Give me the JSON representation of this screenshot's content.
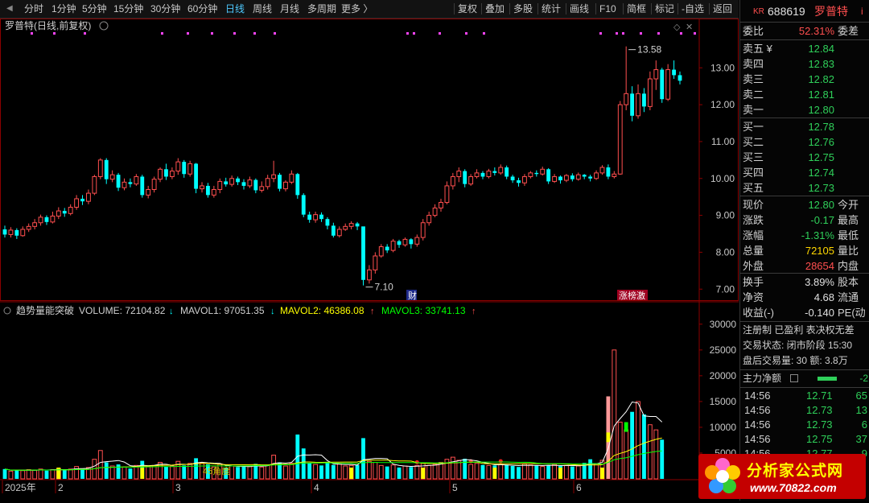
{
  "toolbar": {
    "periods": [
      "分时",
      "1分钟",
      "5分钟",
      "15分钟",
      "30分钟",
      "60分钟",
      "日线",
      "周线",
      "月线",
      "多周期",
      "更多 〉"
    ],
    "active_period": "日线",
    "tools": [
      "复权",
      "叠加",
      "多股",
      "统计",
      "画线",
      "F10",
      "简框",
      "标记",
      "-自选",
      "返回"
    ]
  },
  "chart": {
    "title": "罗普特(日线,前复权)",
    "high_label": "13.58",
    "low_label": "7.10",
    "price_axis": [
      "13.00",
      "12.00",
      "11.00",
      "10.00",
      "9.00",
      "8.00",
      "7.00"
    ],
    "marker_cai": "财",
    "marker_zhang": "涨榜激",
    "indicator_name": "趋势量能突破",
    "volume_label": "VOLUME: 72104.82",
    "mavol1_label": "MAVOL1: 97051.35",
    "mavol2_label": "MAVOL2: 46386.08",
    "mavol3_label": "MAVOL3: 33741.13",
    "vol_axis": [
      "30000",
      "25000",
      "20000",
      "15000",
      "10000",
      "5000"
    ],
    "angle_label": "45角度",
    "date_axis": [
      "2025年",
      "2",
      "3",
      "4",
      "5",
      "6"
    ],
    "colors": {
      "up": "#ff4f4f",
      "down": "#00ffff",
      "ma_white": "#ffffff",
      "ma_yellow": "#ffff00",
      "ma_green": "#00ff00",
      "dot": "#ff44ff"
    }
  },
  "chart_data": {
    "type": "candlestick",
    "ylim": [
      6.7,
      13.9
    ],
    "candles": [
      {
        "o": 8.62,
        "c": 8.48,
        "h": 8.72,
        "l": 8.4
      },
      {
        "o": 8.48,
        "c": 8.6,
        "h": 8.68,
        "l": 8.4
      },
      {
        "o": 8.6,
        "c": 8.45,
        "h": 8.65,
        "l": 8.36
      },
      {
        "o": 8.45,
        "c": 8.62,
        "h": 8.7,
        "l": 8.42
      },
      {
        "o": 8.62,
        "c": 8.7,
        "h": 8.78,
        "l": 8.55
      },
      {
        "o": 8.7,
        "c": 8.8,
        "h": 8.9,
        "l": 8.62
      },
      {
        "o": 8.8,
        "c": 8.95,
        "h": 9.02,
        "l": 8.72
      },
      {
        "o": 8.95,
        "c": 8.82,
        "h": 9.0,
        "l": 8.74
      },
      {
        "o": 8.82,
        "c": 8.98,
        "h": 9.1,
        "l": 8.78
      },
      {
        "o": 8.98,
        "c": 9.12,
        "h": 9.22,
        "l": 8.9
      },
      {
        "o": 9.12,
        "c": 9.05,
        "h": 9.2,
        "l": 8.96
      },
      {
        "o": 9.05,
        "c": 9.22,
        "h": 9.3,
        "l": 9.0
      },
      {
        "o": 9.22,
        "c": 9.45,
        "h": 9.55,
        "l": 9.15
      },
      {
        "o": 9.45,
        "c": 9.38,
        "h": 9.55,
        "l": 9.28
      },
      {
        "o": 9.38,
        "c": 9.6,
        "h": 9.7,
        "l": 9.3
      },
      {
        "o": 9.6,
        "c": 10.05,
        "h": 10.1,
        "l": 9.55
      },
      {
        "o": 10.05,
        "c": 10.5,
        "h": 10.55,
        "l": 9.98
      },
      {
        "o": 10.5,
        "c": 9.98,
        "h": 10.55,
        "l": 9.85
      },
      {
        "o": 9.98,
        "c": 10.1,
        "h": 10.22,
        "l": 9.9
      },
      {
        "o": 10.1,
        "c": 9.75,
        "h": 10.15,
        "l": 9.66
      },
      {
        "o": 9.75,
        "c": 9.9,
        "h": 10.0,
        "l": 9.68
      },
      {
        "o": 9.9,
        "c": 9.85,
        "h": 10.0,
        "l": 9.76
      },
      {
        "o": 9.85,
        "c": 10.05,
        "h": 10.12,
        "l": 9.8
      },
      {
        "o": 10.05,
        "c": 9.55,
        "h": 10.1,
        "l": 9.48
      },
      {
        "o": 9.55,
        "c": 9.7,
        "h": 9.8,
        "l": 9.46
      },
      {
        "o": 9.7,
        "c": 9.98,
        "h": 10.05,
        "l": 9.62
      },
      {
        "o": 9.98,
        "c": 10.25,
        "h": 10.3,
        "l": 9.9
      },
      {
        "o": 10.25,
        "c": 10.05,
        "h": 10.4,
        "l": 9.96
      },
      {
        "o": 10.05,
        "c": 10.2,
        "h": 10.3,
        "l": 9.98
      },
      {
        "o": 10.2,
        "c": 10.45,
        "h": 10.55,
        "l": 10.1
      },
      {
        "o": 10.45,
        "c": 10.12,
        "h": 10.5,
        "l": 10.02
      },
      {
        "o": 10.12,
        "c": 10.4,
        "h": 10.48,
        "l": 10.05
      },
      {
        "o": 10.4,
        "c": 9.72,
        "h": 10.42,
        "l": 9.6
      },
      {
        "o": 9.72,
        "c": 9.8,
        "h": 9.9,
        "l": 9.62
      },
      {
        "o": 9.8,
        "c": 9.55,
        "h": 9.88,
        "l": 9.48
      },
      {
        "o": 9.55,
        "c": 9.7,
        "h": 9.8,
        "l": 9.48
      },
      {
        "o": 9.7,
        "c": 9.92,
        "h": 10.0,
        "l": 9.6
      },
      {
        "o": 9.92,
        "c": 9.84,
        "h": 10.02,
        "l": 9.78
      },
      {
        "o": 9.84,
        "c": 10.0,
        "h": 10.08,
        "l": 9.78
      },
      {
        "o": 10.0,
        "c": 9.9,
        "h": 10.05,
        "l": 9.82
      },
      {
        "o": 9.9,
        "c": 9.8,
        "h": 9.98,
        "l": 9.7
      },
      {
        "o": 9.8,
        "c": 9.96,
        "h": 10.05,
        "l": 9.74
      },
      {
        "o": 9.96,
        "c": 9.68,
        "h": 10.0,
        "l": 9.6
      },
      {
        "o": 9.68,
        "c": 9.78,
        "h": 9.92,
        "l": 9.62
      },
      {
        "o": 9.78,
        "c": 10.0,
        "h": 10.1,
        "l": 9.7
      },
      {
        "o": 10.0,
        "c": 10.1,
        "h": 10.48,
        "l": 9.9
      },
      {
        "o": 10.1,
        "c": 9.72,
        "h": 10.15,
        "l": 9.65
      },
      {
        "o": 9.72,
        "c": 9.9,
        "h": 9.95,
        "l": 9.65
      },
      {
        "o": 9.9,
        "c": 10.12,
        "h": 10.22,
        "l": 9.85
      },
      {
        "o": 10.12,
        "c": 9.55,
        "h": 10.15,
        "l": 9.45
      },
      {
        "o": 9.55,
        "c": 9.02,
        "h": 9.6,
        "l": 8.95
      },
      {
        "o": 9.02,
        "c": 8.88,
        "h": 9.1,
        "l": 8.8
      },
      {
        "o": 8.88,
        "c": 9.02,
        "h": 9.1,
        "l": 8.8
      },
      {
        "o": 9.02,
        "c": 8.9,
        "h": 9.08,
        "l": 8.82
      },
      {
        "o": 8.9,
        "c": 8.72,
        "h": 8.95,
        "l": 8.62
      },
      {
        "o": 8.72,
        "c": 8.45,
        "h": 8.8,
        "l": 8.4
      },
      {
        "o": 8.45,
        "c": 8.62,
        "h": 8.7,
        "l": 8.4
      },
      {
        "o": 8.62,
        "c": 8.7,
        "h": 8.78,
        "l": 8.58
      },
      {
        "o": 8.7,
        "c": 8.78,
        "h": 8.84,
        "l": 8.62
      },
      {
        "o": 8.78,
        "c": 8.7,
        "h": 8.82,
        "l": 8.6
      },
      {
        "o": 8.7,
        "c": 7.25,
        "h": 8.35,
        "l": 7.1
      },
      {
        "o": 7.25,
        "c": 7.52,
        "h": 7.65,
        "l": 7.15
      },
      {
        "o": 7.52,
        "c": 7.9,
        "h": 8.0,
        "l": 7.42
      },
      {
        "o": 7.9,
        "c": 8.15,
        "h": 8.22,
        "l": 7.85
      },
      {
        "o": 8.15,
        "c": 8.05,
        "h": 8.22,
        "l": 7.98
      },
      {
        "o": 8.05,
        "c": 8.3,
        "h": 8.36,
        "l": 8.0
      },
      {
        "o": 8.3,
        "c": 8.2,
        "h": 8.34,
        "l": 8.12
      },
      {
        "o": 8.2,
        "c": 8.35,
        "h": 8.4,
        "l": 8.15
      },
      {
        "o": 8.35,
        "c": 8.22,
        "h": 8.38,
        "l": 8.1
      },
      {
        "o": 8.22,
        "c": 8.4,
        "h": 8.48,
        "l": 8.15
      },
      {
        "o": 8.4,
        "c": 8.8,
        "h": 8.9,
        "l": 8.32
      },
      {
        "o": 8.8,
        "c": 9.0,
        "h": 9.1,
        "l": 8.72
      },
      {
        "o": 9.0,
        "c": 9.2,
        "h": 9.3,
        "l": 8.95
      },
      {
        "o": 9.2,
        "c": 9.35,
        "h": 9.45,
        "l": 9.1
      },
      {
        "o": 9.35,
        "c": 9.8,
        "h": 9.92,
        "l": 9.3
      },
      {
        "o": 9.8,
        "c": 10.05,
        "h": 10.15,
        "l": 9.7
      },
      {
        "o": 10.05,
        "c": 10.2,
        "h": 10.3,
        "l": 9.9
      },
      {
        "o": 10.2,
        "c": 9.85,
        "h": 10.25,
        "l": 9.76
      },
      {
        "o": 9.85,
        "c": 10.05,
        "h": 10.12,
        "l": 9.8
      },
      {
        "o": 10.05,
        "c": 10.15,
        "h": 10.25,
        "l": 10.0
      },
      {
        "o": 10.15,
        "c": 10.05,
        "h": 10.2,
        "l": 9.98
      },
      {
        "o": 10.05,
        "c": 10.2,
        "h": 10.26,
        "l": 10.0
      },
      {
        "o": 10.2,
        "c": 10.15,
        "h": 10.3,
        "l": 10.08
      },
      {
        "o": 10.15,
        "c": 10.3,
        "h": 10.38,
        "l": 10.1
      },
      {
        "o": 10.3,
        "c": 10.05,
        "h": 10.35,
        "l": 9.98
      },
      {
        "o": 10.05,
        "c": 9.95,
        "h": 10.1,
        "l": 9.88
      },
      {
        "o": 9.95,
        "c": 9.88,
        "h": 10.02,
        "l": 9.78
      },
      {
        "o": 9.88,
        "c": 10.05,
        "h": 10.12,
        "l": 9.8
      },
      {
        "o": 10.05,
        "c": 10.15,
        "h": 10.2,
        "l": 10.0
      },
      {
        "o": 10.15,
        "c": 10.12,
        "h": 10.22,
        "l": 10.05
      },
      {
        "o": 10.12,
        "c": 10.25,
        "h": 10.32,
        "l": 10.08
      },
      {
        "o": 10.25,
        "c": 9.92,
        "h": 10.28,
        "l": 9.85
      },
      {
        "o": 9.92,
        "c": 10.05,
        "h": 10.12,
        "l": 9.88
      },
      {
        "o": 10.05,
        "c": 9.95,
        "h": 10.08,
        "l": 9.86
      },
      {
        "o": 9.95,
        "c": 10.08,
        "h": 10.12,
        "l": 9.9
      },
      {
        "o": 10.08,
        "c": 9.98,
        "h": 10.14,
        "l": 9.92
      },
      {
        "o": 9.98,
        "c": 10.1,
        "h": 10.16,
        "l": 9.94
      },
      {
        "o": 10.1,
        "c": 10.05,
        "h": 10.12,
        "l": 9.98
      },
      {
        "o": 10.05,
        "c": 10.0,
        "h": 10.1,
        "l": 9.92
      },
      {
        "o": 10.0,
        "c": 10.15,
        "h": 10.22,
        "l": 9.96
      },
      {
        "o": 10.15,
        "c": 10.3,
        "h": 10.36,
        "l": 10.1
      },
      {
        "o": 10.3,
        "c": 10.05,
        "h": 10.38,
        "l": 9.98
      },
      {
        "o": 10.05,
        "c": 10.12,
        "h": 10.2,
        "l": 10.0
      },
      {
        "o": 10.12,
        "c": 12.0,
        "h": 12.1,
        "l": 10.1
      },
      {
        "o": 12.0,
        "c": 12.3,
        "h": 13.58,
        "l": 11.85
      },
      {
        "o": 12.3,
        "c": 11.7,
        "h": 12.5,
        "l": 11.55
      },
      {
        "o": 11.7,
        "c": 12.3,
        "h": 12.55,
        "l": 11.62
      },
      {
        "o": 12.3,
        "c": 11.95,
        "h": 12.45,
        "l": 11.8
      },
      {
        "o": 11.95,
        "c": 12.7,
        "h": 12.9,
        "l": 11.85
      },
      {
        "o": 12.7,
        "c": 12.95,
        "h": 13.2,
        "l": 12.4
      },
      {
        "o": 12.95,
        "c": 12.15,
        "h": 13.0,
        "l": 12.05
      },
      {
        "o": 12.15,
        "c": 12.95,
        "h": 13.1,
        "l": 12.1
      },
      {
        "o": 12.95,
        "c": 12.8,
        "h": 13.2,
        "l": 12.7
      },
      {
        "o": 12.8,
        "c": 12.65,
        "h": 12.9,
        "l": 12.55
      }
    ],
    "volumes": [
      1900,
      1500,
      1700,
      1600,
      1800,
      1700,
      1900,
      1600,
      1800,
      2000,
      1700,
      1900,
      2400,
      2000,
      2200,
      3800,
      5500,
      3200,
      2500,
      2800,
      2300,
      2000,
      2600,
      3500,
      2400,
      2600,
      3200,
      2400,
      2500,
      3400,
      2600,
      3000,
      4000,
      3100,
      2800,
      2300,
      2900,
      2100,
      2500,
      2300,
      2400,
      2500,
      2900,
      2300,
      2600,
      4600,
      3200,
      2500,
      3000,
      8600,
      5900,
      3100,
      2800,
      2600,
      3300,
      2700,
      2900,
      2500,
      2600,
      2700,
      7900,
      3400,
      3200,
      2600,
      2400,
      2700,
      2200,
      2500,
      2300,
      2600,
      3000,
      2600,
      2800,
      3200,
      3800,
      4200,
      3600,
      3900,
      2800,
      3000,
      2700,
      2600,
      2600,
      2800,
      2700,
      2500,
      2300,
      2900,
      2700,
      2600,
      2400,
      2600,
      2800,
      2500,
      2600,
      2400,
      2500,
      3100,
      3800,
      2900,
      3600,
      16000,
      25000,
      11000,
      9500,
      13000,
      15000,
      12500,
      10500,
      9500,
      7600
    ]
  },
  "right": {
    "code_prefix": "KR",
    "code": "688619",
    "name": "罗普特",
    "info_icon": "i",
    "weibi_label": "委比",
    "weibi_value": "52.31%",
    "weicha_label": "委差",
    "asks": [
      {
        "label": "卖五 ¥",
        "price": "12.84"
      },
      {
        "label": "卖四",
        "price": "12.83"
      },
      {
        "label": "卖三",
        "price": "12.82"
      },
      {
        "label": "卖二",
        "price": "12.81"
      },
      {
        "label": "卖一",
        "price": "12.80"
      }
    ],
    "bids": [
      {
        "label": "买一",
        "price": "12.78"
      },
      {
        "label": "买二",
        "price": "12.76"
      },
      {
        "label": "买三",
        "price": "12.75"
      },
      {
        "label": "买四",
        "price": "12.74"
      },
      {
        "label": "买五",
        "price": "12.73"
      }
    ],
    "stats": [
      {
        "label": "现价",
        "value": "12.80",
        "extra": "今开",
        "cls": "grn"
      },
      {
        "label": "涨跌",
        "value": "-0.17",
        "extra": "最高",
        "cls": "grn"
      },
      {
        "label": "涨幅",
        "value": "-1.31%",
        "extra": "最低",
        "cls": "grn"
      },
      {
        "label": "总量",
        "value": "72105",
        "extra": "量比",
        "cls": "yel"
      },
      {
        "label": "外盘",
        "value": "28654",
        "extra": "内盘",
        "cls": "red"
      }
    ],
    "stats2": [
      {
        "label": "换手",
        "value": "3.89%",
        "extra": "股本",
        "cls": "wht"
      },
      {
        "label": "净资",
        "value": "4.68",
        "extra": "流通",
        "cls": "wht"
      },
      {
        "label": "收益(-)",
        "value": "-0.140",
        "extra": "PE(动",
        "cls": "wht"
      }
    ],
    "reg_line": "注册制  已盈利  表决权无差",
    "trade_status": "交易状态: 闭市阶段 15:30",
    "after_hours": "盘后交易量: 30  额: 3.8万",
    "main_flow_label": "主力净额",
    "main_flow_value": "-2",
    "ticks": [
      {
        "t": "14:56",
        "p": "12.71",
        "v": "65"
      },
      {
        "t": "14:56",
        "p": "12.73",
        "v": "13"
      },
      {
        "t": "14:56",
        "p": "12.73",
        "v": "6"
      },
      {
        "t": "14:56",
        "p": "12.75",
        "v": "37"
      },
      {
        "t": "14:56",
        "p": "12.77",
        "v": "9"
      }
    ]
  },
  "watermark": {
    "name": "分析家公式网",
    "url": "www.70822.com"
  }
}
